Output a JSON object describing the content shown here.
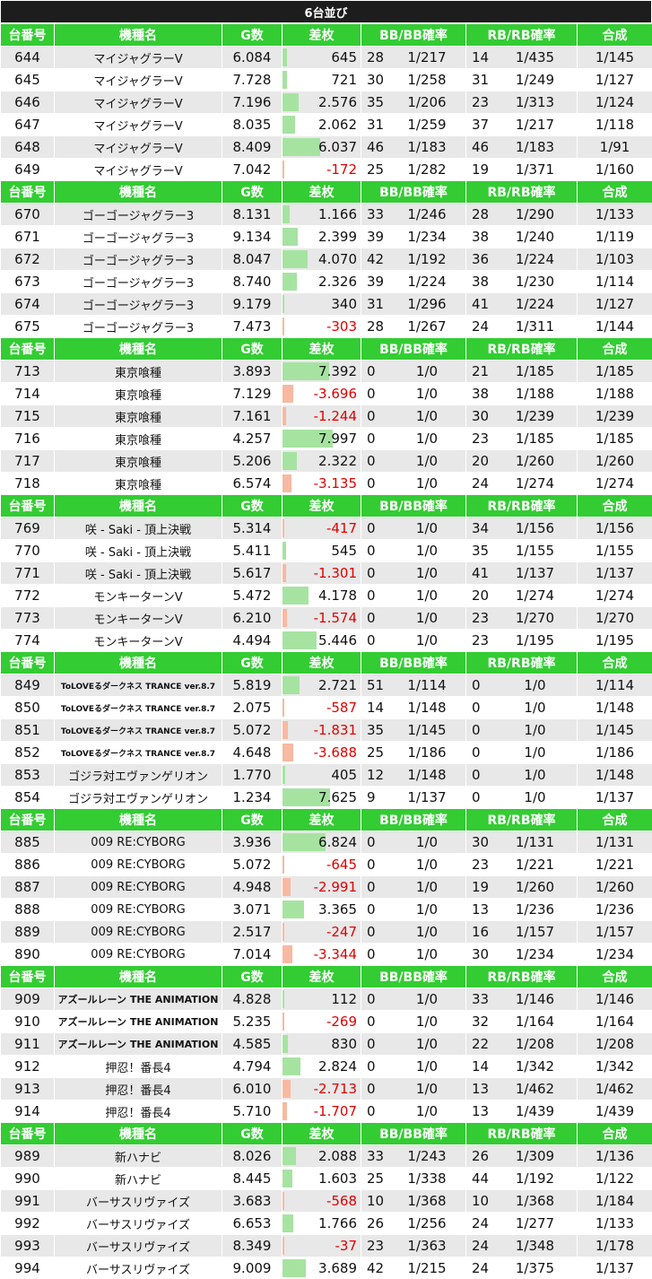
{
  "title": "6台並び",
  "headers": [
    "台番号",
    "機種名",
    "G数",
    "差枚",
    "BB/BB確率",
    "RB/RB確率",
    "合成"
  ],
  "colors": {
    "header_bg": "#33cc33",
    "title_bg": "#1d1d1d",
    "pos_bar": "#a6e3a1",
    "neg_bar": "#f7b9a1",
    "neg_text": "#e00000"
  },
  "diff_scale_max": 8000,
  "groups": [
    {
      "rows": [
        {
          "no": "644",
          "name": "マイジャグラーV",
          "g": "6.084",
          "diff": "645",
          "d": 645,
          "bb": "28",
          "bbr": "1/217",
          "rb": "14",
          "rbr": "1/435",
          "total": "1/145"
        },
        {
          "no": "645",
          "name": "マイジャグラーV",
          "g": "7.728",
          "diff": "721",
          "d": 721,
          "bb": "30",
          "bbr": "1/258",
          "rb": "31",
          "rbr": "1/249",
          "total": "1/127"
        },
        {
          "no": "646",
          "name": "マイジャグラーV",
          "g": "7.196",
          "diff": "2.576",
          "d": 2576,
          "bb": "35",
          "bbr": "1/206",
          "rb": "23",
          "rbr": "1/313",
          "total": "1/124"
        },
        {
          "no": "647",
          "name": "マイジャグラーV",
          "g": "8.035",
          "diff": "2.062",
          "d": 2062,
          "bb": "31",
          "bbr": "1/259",
          "rb": "37",
          "rbr": "1/217",
          "total": "1/118"
        },
        {
          "no": "648",
          "name": "マイジャグラーV",
          "g": "8.409",
          "diff": "6.037",
          "d": 6037,
          "bb": "46",
          "bbr": "1/183",
          "rb": "46",
          "rbr": "1/183",
          "total": "1/91"
        },
        {
          "no": "649",
          "name": "マイジャグラーV",
          "g": "7.042",
          "diff": "-172",
          "d": -172,
          "bb": "25",
          "bbr": "1/282",
          "rb": "19",
          "rbr": "1/371",
          "total": "1/160"
        }
      ]
    },
    {
      "rows": [
        {
          "no": "670",
          "name": "ゴーゴージャグラー3",
          "g": "8.131",
          "diff": "1.166",
          "d": 1166,
          "bb": "33",
          "bbr": "1/246",
          "rb": "28",
          "rbr": "1/290",
          "total": "1/133"
        },
        {
          "no": "671",
          "name": "ゴーゴージャグラー3",
          "g": "9.134",
          "diff": "2.399",
          "d": 2399,
          "bb": "39",
          "bbr": "1/234",
          "rb": "38",
          "rbr": "1/240",
          "total": "1/119"
        },
        {
          "no": "672",
          "name": "ゴーゴージャグラー3",
          "g": "8.047",
          "diff": "4.070",
          "d": 4070,
          "bb": "42",
          "bbr": "1/192",
          "rb": "36",
          "rbr": "1/224",
          "total": "1/103"
        },
        {
          "no": "673",
          "name": "ゴーゴージャグラー3",
          "g": "8.740",
          "diff": "2.326",
          "d": 2326,
          "bb": "39",
          "bbr": "1/224",
          "rb": "38",
          "rbr": "1/230",
          "total": "1/114"
        },
        {
          "no": "674",
          "name": "ゴーゴージャグラー3",
          "g": "9.179",
          "diff": "340",
          "d": 340,
          "bb": "31",
          "bbr": "1/296",
          "rb": "41",
          "rbr": "1/224",
          "total": "1/127"
        },
        {
          "no": "675",
          "name": "ゴーゴージャグラー3",
          "g": "7.473",
          "diff": "-303",
          "d": -303,
          "bb": "28",
          "bbr": "1/267",
          "rb": "24",
          "rbr": "1/311",
          "total": "1/144"
        }
      ]
    },
    {
      "rows": [
        {
          "no": "713",
          "name": "東京喰種",
          "g": "3.893",
          "diff": "7.392",
          "d": 7392,
          "bb": "0",
          "bbr": "1/0",
          "rb": "21",
          "rbr": "1/185",
          "total": "1/185"
        },
        {
          "no": "714",
          "name": "東京喰種",
          "g": "7.129",
          "diff": "-3.696",
          "d": -3696,
          "bb": "0",
          "bbr": "1/0",
          "rb": "38",
          "rbr": "1/188",
          "total": "1/188"
        },
        {
          "no": "715",
          "name": "東京喰種",
          "g": "7.161",
          "diff": "-1.244",
          "d": -1244,
          "bb": "0",
          "bbr": "1/0",
          "rb": "30",
          "rbr": "1/239",
          "total": "1/239"
        },
        {
          "no": "716",
          "name": "東京喰種",
          "g": "4.257",
          "diff": "7.997",
          "d": 7997,
          "bb": "0",
          "bbr": "1/0",
          "rb": "23",
          "rbr": "1/185",
          "total": "1/185"
        },
        {
          "no": "717",
          "name": "東京喰種",
          "g": "5.206",
          "diff": "2.322",
          "d": 2322,
          "bb": "0",
          "bbr": "1/0",
          "rb": "20",
          "rbr": "1/260",
          "total": "1/260"
        },
        {
          "no": "718",
          "name": "東京喰種",
          "g": "6.574",
          "diff": "-3.135",
          "d": -3135,
          "bb": "0",
          "bbr": "1/0",
          "rb": "24",
          "rbr": "1/274",
          "total": "1/274"
        }
      ]
    },
    {
      "rows": [
        {
          "no": "769",
          "name": "咲 - Saki - 頂上決戦",
          "g": "5.314",
          "diff": "-417",
          "d": -417,
          "bb": "0",
          "bbr": "1/0",
          "rb": "34",
          "rbr": "1/156",
          "total": "1/156"
        },
        {
          "no": "770",
          "name": "咲 - Saki - 頂上決戦",
          "g": "5.411",
          "diff": "545",
          "d": 545,
          "bb": "0",
          "bbr": "1/0",
          "rb": "35",
          "rbr": "1/155",
          "total": "1/155"
        },
        {
          "no": "771",
          "name": "咲 - Saki - 頂上決戦",
          "g": "5.617",
          "diff": "-1.301",
          "d": -1301,
          "bb": "0",
          "bbr": "1/0",
          "rb": "41",
          "rbr": "1/137",
          "total": "1/137"
        },
        {
          "no": "772",
          "name": "モンキーターンV",
          "g": "5.472",
          "diff": "4.178",
          "d": 4178,
          "bb": "0",
          "bbr": "1/0",
          "rb": "20",
          "rbr": "1/274",
          "total": "1/274"
        },
        {
          "no": "773",
          "name": "モンキーターンV",
          "g": "6.210",
          "diff": "-1.574",
          "d": -1574,
          "bb": "0",
          "bbr": "1/0",
          "rb": "23",
          "rbr": "1/270",
          "total": "1/270"
        },
        {
          "no": "774",
          "name": "モンキーターンV",
          "g": "4.494",
          "diff": "5.446",
          "d": 5446,
          "bb": "0",
          "bbr": "1/0",
          "rb": "23",
          "rbr": "1/195",
          "total": "1/195"
        }
      ]
    },
    {
      "rows": [
        {
          "no": "849",
          "name": "ToLOVEるダークネス TRANCE ver.8.7",
          "g": "5.819",
          "diff": "2.721",
          "d": 2721,
          "bb": "51",
          "bbr": "1/114",
          "rb": "0",
          "rbr": "1/0",
          "total": "1/114"
        },
        {
          "no": "850",
          "name": "ToLOVEるダークネス TRANCE ver.8.7",
          "g": "2.075",
          "diff": "-587",
          "d": -587,
          "bb": "14",
          "bbr": "1/148",
          "rb": "0",
          "rbr": "1/0",
          "total": "1/148"
        },
        {
          "no": "851",
          "name": "ToLOVEるダークネス TRANCE ver.8.7",
          "g": "5.072",
          "diff": "-1.831",
          "d": -1831,
          "bb": "35",
          "bbr": "1/145",
          "rb": "0",
          "rbr": "1/0",
          "total": "1/145"
        },
        {
          "no": "852",
          "name": "ToLOVEるダークネス TRANCE ver.8.7",
          "g": "4.648",
          "diff": "-3.688",
          "d": -3688,
          "bb": "25",
          "bbr": "1/186",
          "rb": "0",
          "rbr": "1/0",
          "total": "1/186"
        },
        {
          "no": "853",
          "name": "ゴジラ対エヴァンゲリオン",
          "g": "1.770",
          "diff": "405",
          "d": 405,
          "bb": "12",
          "bbr": "1/148",
          "rb": "0",
          "rbr": "1/0",
          "total": "1/148"
        },
        {
          "no": "854",
          "name": "ゴジラ対エヴァンゲリオン",
          "g": "1.234",
          "diff": "7.625",
          "d": 7625,
          "bb": "9",
          "bbr": "1/137",
          "rb": "0",
          "rbr": "1/0",
          "total": "1/137"
        }
      ]
    },
    {
      "rows": [
        {
          "no": "885",
          "name": "009 RE:CYBORG",
          "g": "3.936",
          "diff": "6.824",
          "d": 6824,
          "bb": "0",
          "bbr": "1/0",
          "rb": "30",
          "rbr": "1/131",
          "total": "1/131"
        },
        {
          "no": "886",
          "name": "009 RE:CYBORG",
          "g": "5.072",
          "diff": "-645",
          "d": -645,
          "bb": "0",
          "bbr": "1/0",
          "rb": "23",
          "rbr": "1/221",
          "total": "1/221"
        },
        {
          "no": "887",
          "name": "009 RE:CYBORG",
          "g": "4.948",
          "diff": "-2.991",
          "d": -2991,
          "bb": "0",
          "bbr": "1/0",
          "rb": "19",
          "rbr": "1/260",
          "total": "1/260"
        },
        {
          "no": "888",
          "name": "009 RE:CYBORG",
          "g": "3.071",
          "diff": "3.365",
          "d": 3365,
          "bb": "0",
          "bbr": "1/0",
          "rb": "13",
          "rbr": "1/236",
          "total": "1/236"
        },
        {
          "no": "889",
          "name": "009 RE:CYBORG",
          "g": "2.517",
          "diff": "-247",
          "d": -247,
          "bb": "0",
          "bbr": "1/0",
          "rb": "16",
          "rbr": "1/157",
          "total": "1/157"
        },
        {
          "no": "890",
          "name": "009 RE:CYBORG",
          "g": "7.014",
          "diff": "-3.344",
          "d": -3344,
          "bb": "0",
          "bbr": "1/0",
          "rb": "30",
          "rbr": "1/234",
          "total": "1/234"
        }
      ]
    },
    {
      "rows": [
        {
          "no": "909",
          "name": "アズールレーン THE ANIMATION",
          "g": "4.828",
          "diff": "112",
          "d": 112,
          "bb": "0",
          "bbr": "1/0",
          "rb": "33",
          "rbr": "1/146",
          "total": "1/146"
        },
        {
          "no": "910",
          "name": "アズールレーン THE ANIMATION",
          "g": "5.235",
          "diff": "-269",
          "d": -269,
          "bb": "0",
          "bbr": "1/0",
          "rb": "32",
          "rbr": "1/164",
          "total": "1/164"
        },
        {
          "no": "911",
          "name": "アズールレーン THE ANIMATION",
          "g": "4.585",
          "diff": "830",
          "d": 830,
          "bb": "0",
          "bbr": "1/0",
          "rb": "22",
          "rbr": "1/208",
          "total": "1/208"
        },
        {
          "no": "912",
          "name": "押忍！番長4",
          "g": "4.794",
          "diff": "2.824",
          "d": 2824,
          "bb": "0",
          "bbr": "1/0",
          "rb": "14",
          "rbr": "1/342",
          "total": "1/342"
        },
        {
          "no": "913",
          "name": "押忍！番長4",
          "g": "6.010",
          "diff": "-2.713",
          "d": -2713,
          "bb": "0",
          "bbr": "1/0",
          "rb": "13",
          "rbr": "1/462",
          "total": "1/462"
        },
        {
          "no": "914",
          "name": "押忍！番長4",
          "g": "5.710",
          "diff": "-1.707",
          "d": -1707,
          "bb": "0",
          "bbr": "1/0",
          "rb": "13",
          "rbr": "1/439",
          "total": "1/439"
        }
      ]
    },
    {
      "rows": [
        {
          "no": "989",
          "name": "新ハナビ",
          "g": "8.026",
          "diff": "2.088",
          "d": 2088,
          "bb": "33",
          "bbr": "1/243",
          "rb": "26",
          "rbr": "1/309",
          "total": "1/136"
        },
        {
          "no": "990",
          "name": "新ハナビ",
          "g": "8.445",
          "diff": "1.603",
          "d": 1603,
          "bb": "25",
          "bbr": "1/338",
          "rb": "44",
          "rbr": "1/192",
          "total": "1/122"
        },
        {
          "no": "991",
          "name": "バーサスリヴァイズ",
          "g": "3.683",
          "diff": "-568",
          "d": -568,
          "bb": "10",
          "bbr": "1/368",
          "rb": "10",
          "rbr": "1/368",
          "total": "1/184"
        },
        {
          "no": "992",
          "name": "バーサスリヴァイズ",
          "g": "6.653",
          "diff": "1.766",
          "d": 1766,
          "bb": "26",
          "bbr": "1/256",
          "rb": "24",
          "rbr": "1/277",
          "total": "1/133"
        },
        {
          "no": "993",
          "name": "バーサスリヴァイズ",
          "g": "8.349",
          "diff": "-37",
          "d": -37,
          "bb": "23",
          "bbr": "1/363",
          "rb": "24",
          "rbr": "1/348",
          "total": "1/178"
        },
        {
          "no": "994",
          "name": "バーサスリヴァイズ",
          "g": "9.009",
          "diff": "3.689",
          "d": 3689,
          "bb": "42",
          "bbr": "1/215",
          "rb": "24",
          "rbr": "1/375",
          "total": "1/137"
        }
      ]
    }
  ]
}
